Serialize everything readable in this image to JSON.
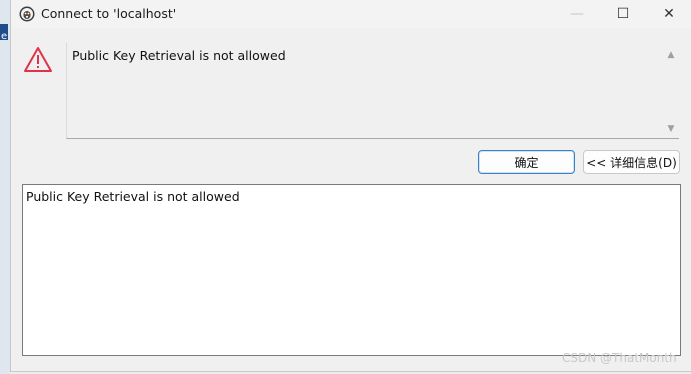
{
  "window": {
    "title": "Connect to 'localhost'",
    "controls": {
      "minimize": "—",
      "maximize": "☐",
      "close": "✕"
    }
  },
  "background": {
    "fragment_text": "e"
  },
  "dialog": {
    "icon": "warning-triangle-icon",
    "icon_color": "#e0334a",
    "message": "Public Key Retrieval is not allowed",
    "ok_label": "确定",
    "details_label": "<< 详细信息(D)",
    "details_text": "Public Key Retrieval is not allowed"
  },
  "watermark": "CSDN @ThatMonth",
  "colors": {
    "accent_border": "#3f7fc4"
  }
}
